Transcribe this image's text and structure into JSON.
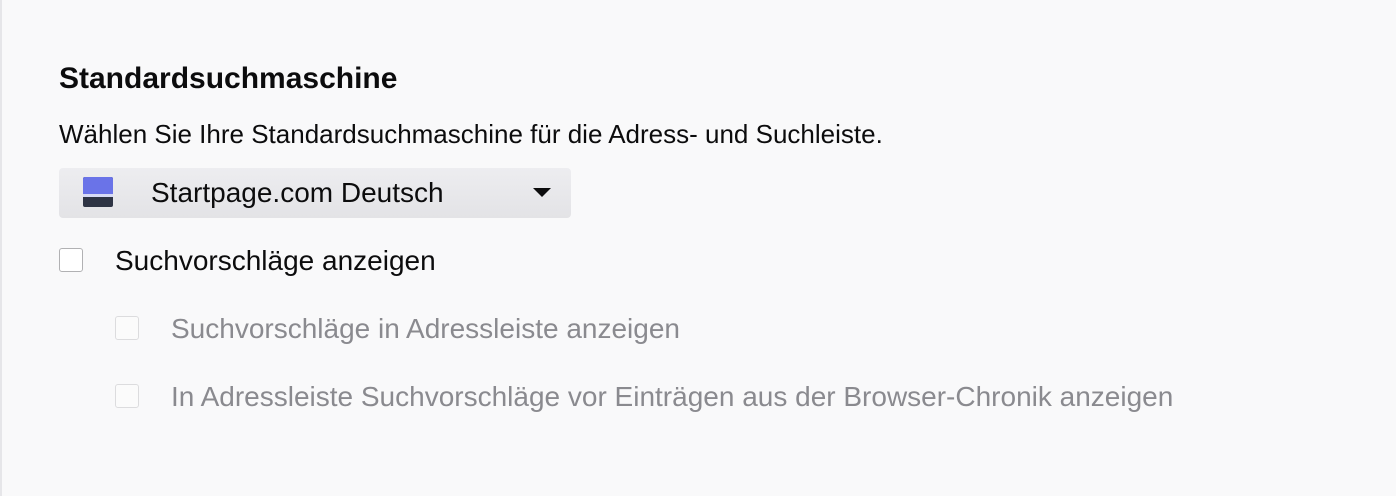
{
  "search_engine_section": {
    "title": "Standardsuchmaschine",
    "description": "Wählen Sie Ihre Standardsuchmaschine für die Adress- und Suchleiste.",
    "dropdown": {
      "selected": "Startpage.com Deutsch",
      "icon": "startpage-icon",
      "icon_colors": {
        "top": "#6a73e8",
        "bottom": "#2e3444"
      }
    },
    "options": [
      {
        "label": "Suchvorschläge anzeigen",
        "checked": false,
        "enabled": true
      },
      {
        "label": "Suchvorschläge in Adressleiste anzeigen",
        "checked": false,
        "enabled": false
      },
      {
        "label": "In Adressleiste Suchvorschläge vor Einträgen aus der Browser-Chronik anzeigen",
        "checked": false,
        "enabled": false
      }
    ]
  }
}
